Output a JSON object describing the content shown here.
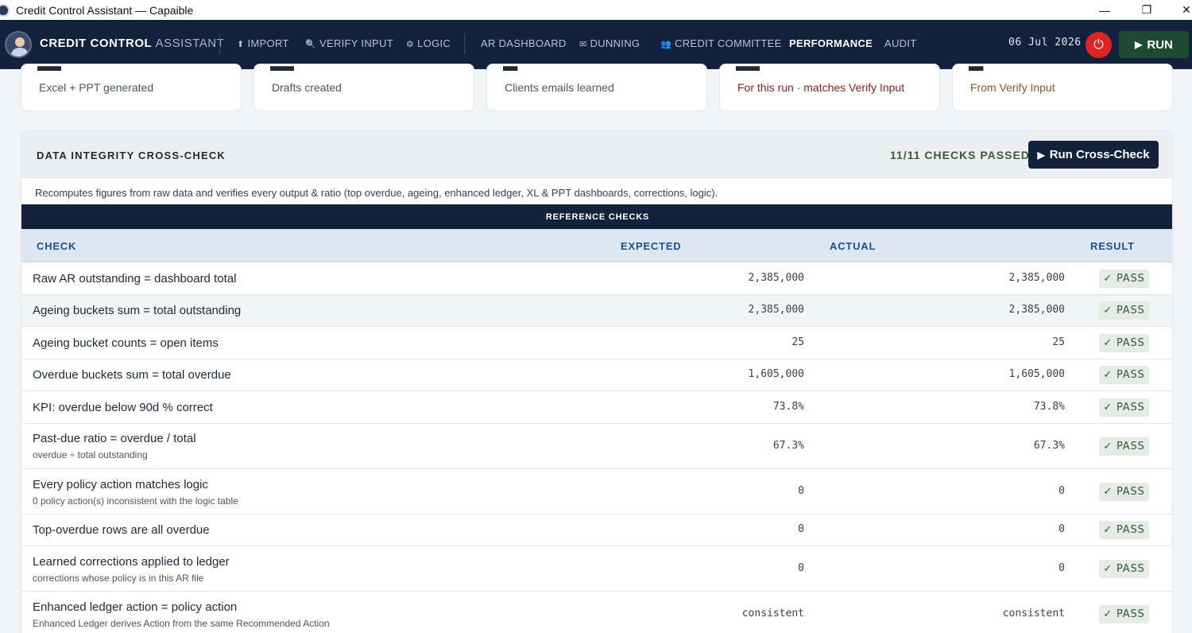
{
  "window": {
    "title": "Credit Control Assistant — Capaible",
    "minimize": "—",
    "restore": "❐",
    "close": "✕"
  },
  "nav": {
    "brand_bold": "CREDIT CONTROL",
    "brand_light": "ASSISTANT",
    "items": [
      {
        "icon": "⬆",
        "label": "IMPORT"
      },
      {
        "icon": "🔍",
        "label": "VERIFY INPUT"
      },
      {
        "icon": "⚙",
        "label": "LOGIC"
      },
      {
        "icon": "",
        "label": "AR DASHBOARD"
      },
      {
        "icon": "✉",
        "label": "DUNNING"
      },
      {
        "icon": "👥",
        "label": "CREDIT COMMITTEE"
      },
      {
        "icon": "",
        "label": "PERFORMANCE"
      },
      {
        "icon": "",
        "label": "AUDIT"
      }
    ],
    "active": "PERFORMANCE",
    "date": "06 Jul 2026",
    "power_icon": "⏻",
    "run_label": "RUN"
  },
  "cards": [
    {
      "sub": "Excel + PPT generated",
      "tone": "normal"
    },
    {
      "sub": "Drafts created",
      "tone": "normal"
    },
    {
      "sub": "Clients emails learned",
      "tone": "normal"
    },
    {
      "sub": "For this run · matches Verify Input",
      "tone": "red"
    },
    {
      "sub": "From Verify Input",
      "tone": "amber"
    }
  ],
  "integrity": {
    "title": "DATA INTEGRITY CROSS-CHECK",
    "passed": "11/11 CHECKS PASSED",
    "run_button": "Run Cross-Check",
    "description": "Recomputes figures from raw data and verifies every output & ratio (top overdue, ageing, enhanced ledger, XL & PPT dashboards, corrections, logic).",
    "section": "REFERENCE CHECKS",
    "columns": {
      "check": "CHECK",
      "expected": "EXPECTED",
      "actual": "ACTUAL",
      "result": "RESULT"
    },
    "rows": [
      {
        "check": "Raw AR outstanding = dashboard total",
        "note": "",
        "expected": "2,385,000",
        "actual": "2,385,000",
        "result": "✓ PASS"
      },
      {
        "check": "Ageing buckets sum = total outstanding",
        "note": "",
        "expected": "2,385,000",
        "actual": "2,385,000",
        "result": "✓ PASS"
      },
      {
        "check": "Ageing bucket counts = open items",
        "note": "",
        "expected": "25",
        "actual": "25",
        "result": "✓ PASS"
      },
      {
        "check": "Overdue buckets sum = total overdue",
        "note": "",
        "expected": "1,605,000",
        "actual": "1,605,000",
        "result": "✓ PASS"
      },
      {
        "check": "KPI: overdue below 90d % correct",
        "note": "",
        "expected": "73.8%",
        "actual": "73.8%",
        "result": "✓ PASS"
      },
      {
        "check": "Past-due ratio = overdue / total",
        "note": "overdue ÷ total outstanding",
        "expected": "67.3%",
        "actual": "67.3%",
        "result": "✓ PASS"
      },
      {
        "check": "Every policy action matches logic",
        "note": "0 policy action(s) inconsistent with the logic table",
        "expected": "0",
        "actual": "0",
        "result": "✓ PASS"
      },
      {
        "check": "Top-overdue rows are all overdue",
        "note": "",
        "expected": "0",
        "actual": "0",
        "result": "✓ PASS"
      },
      {
        "check": "Learned corrections applied to ledger",
        "note": "corrections whose policy is in this AR file",
        "expected": "0",
        "actual": "0",
        "result": "✓ PASS"
      },
      {
        "check": "Enhanced ledger action = policy action",
        "note": "Enhanced Ledger derives Action from the same Recommended Action",
        "expected": "consistent",
        "actual": "consistent",
        "result": "✓ PASS"
      }
    ]
  }
}
